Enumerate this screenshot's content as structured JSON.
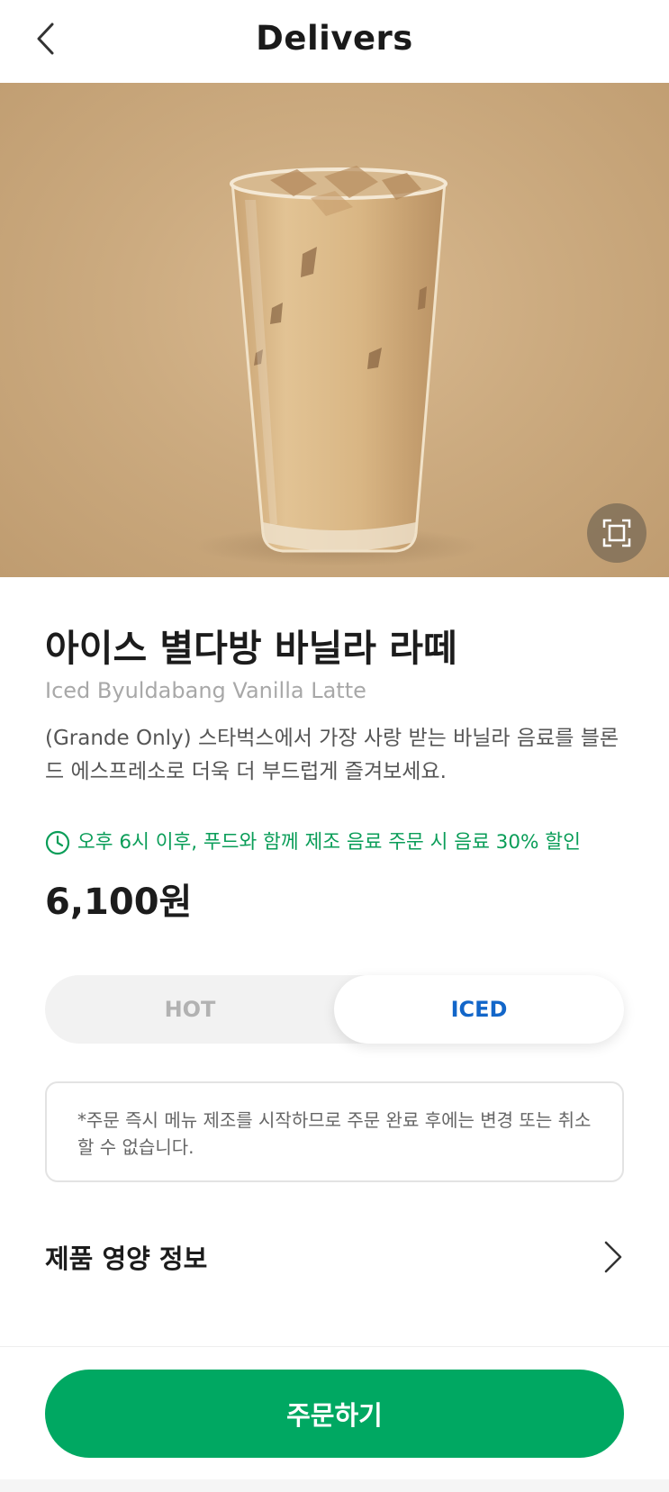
{
  "header": {
    "title": "Delivers",
    "back_icon": "chevron-left-icon"
  },
  "hero": {
    "image_subject": "Iced latte in a clear glass on a beige background",
    "expand_icon": "expand-icon"
  },
  "product": {
    "name_ko": "아이스 별다방 바닐라 라떼",
    "name_en": "Iced Byuldabang Vanilla Latte",
    "description": "(Grande Only) 스타벅스에서 가장 사랑 받는 바닐라 음료를 블론드 에스프레소로 더욱 더 부드럽게 즐겨보세요.",
    "promo_icon": "clock-icon",
    "promo_text": "오후 6시 이후, 푸드와 함께 제조 음료 주문 시 음료 30% 할인",
    "price": "6,100원"
  },
  "temperature": {
    "hot_label": "HOT",
    "iced_label": "ICED",
    "selected": "ICED"
  },
  "notice": {
    "text": "*주문 즉시 메뉴 제조를 시작하므로 주문 완료 후에는 변경 또는 취소할 수 없습니다."
  },
  "nutrition": {
    "label": "제품 영양 정보",
    "icon": "chevron-right-icon"
  },
  "order": {
    "button_label": "주문하기"
  },
  "colors": {
    "brand_green": "#00a862",
    "promo_green": "#0a9d58",
    "selected_blue": "#1266c9",
    "hero_background": "#ccab80"
  }
}
